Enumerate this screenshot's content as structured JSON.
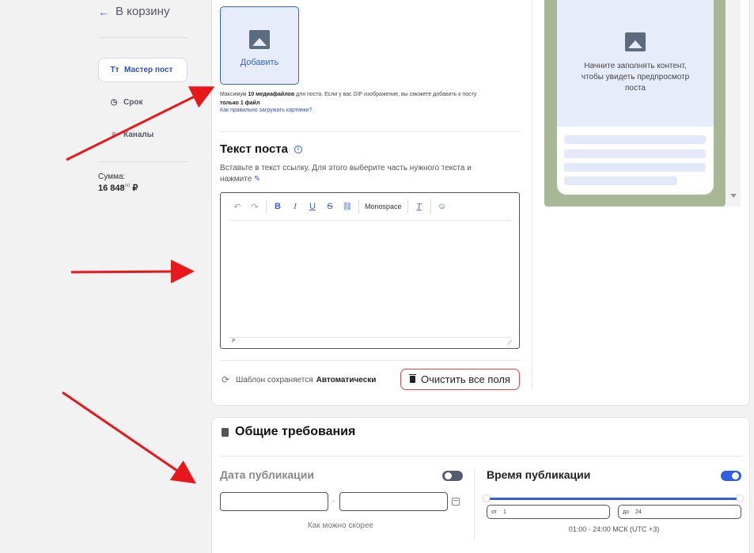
{
  "sidebar": {
    "back_label": "В корзину",
    "items": [
      {
        "label": "Мастер пост",
        "icon": "text-format-icon",
        "active": true
      },
      {
        "label": "Срок",
        "icon": "timer-icon",
        "active": false
      },
      {
        "label": "Каналы",
        "icon": "list-icon",
        "active": false
      }
    ],
    "sum_label": "Сумма:",
    "sum_value": "16 848",
    "sum_cents": "00",
    "currency": "₽"
  },
  "upload": {
    "button_label": "Добавить",
    "hint_prefix": "Максимум ",
    "hint_bold": "10 медиафайлов",
    "hint_rest": " для поста. Если у вас GIF изображение, вы сможете добавить к посту ",
    "hint_bold2": "только 1 файл",
    "help_link": "Как правильно загружать картинки?"
  },
  "post_text": {
    "title": "Текст поста",
    "description": "Вставьте в текст ссылку. Для этого выберите часть нужного текста и нажмите",
    "toolbar": {
      "undo": "↶",
      "redo": "↷",
      "bold": "B",
      "italic": "I",
      "underline": "U",
      "strike": "S",
      "link": "🔗",
      "monospace": "Monospace",
      "clear_format": "T",
      "emoji": "☺"
    },
    "path_marker": "P"
  },
  "footer": {
    "autosave_prefix": "Шаблон сохраняется",
    "autosave_mode": "Автоматически",
    "clear_button": "Очистить все поля"
  },
  "preview": {
    "placeholder": "Начните заполнять контент, чтобы увидеть предпросмотр поста"
  },
  "requirements": {
    "title": "Общие требования",
    "date_title": "Дата публикации",
    "date_toggle": false,
    "asap_label": "Как можно скорее",
    "date_separator": "-",
    "time_title": "Время публикации",
    "time_toggle": true,
    "from_label": "от",
    "from_value": "1",
    "to_label": "до",
    "to_value": "24",
    "time_range": "01:00 - 24:00 МСК (UTC +3)"
  },
  "colors": {
    "accent": "#2f5fe0",
    "danger": "#e04646",
    "arrow": "#e8171c",
    "preview_bg": "#a8b796"
  }
}
